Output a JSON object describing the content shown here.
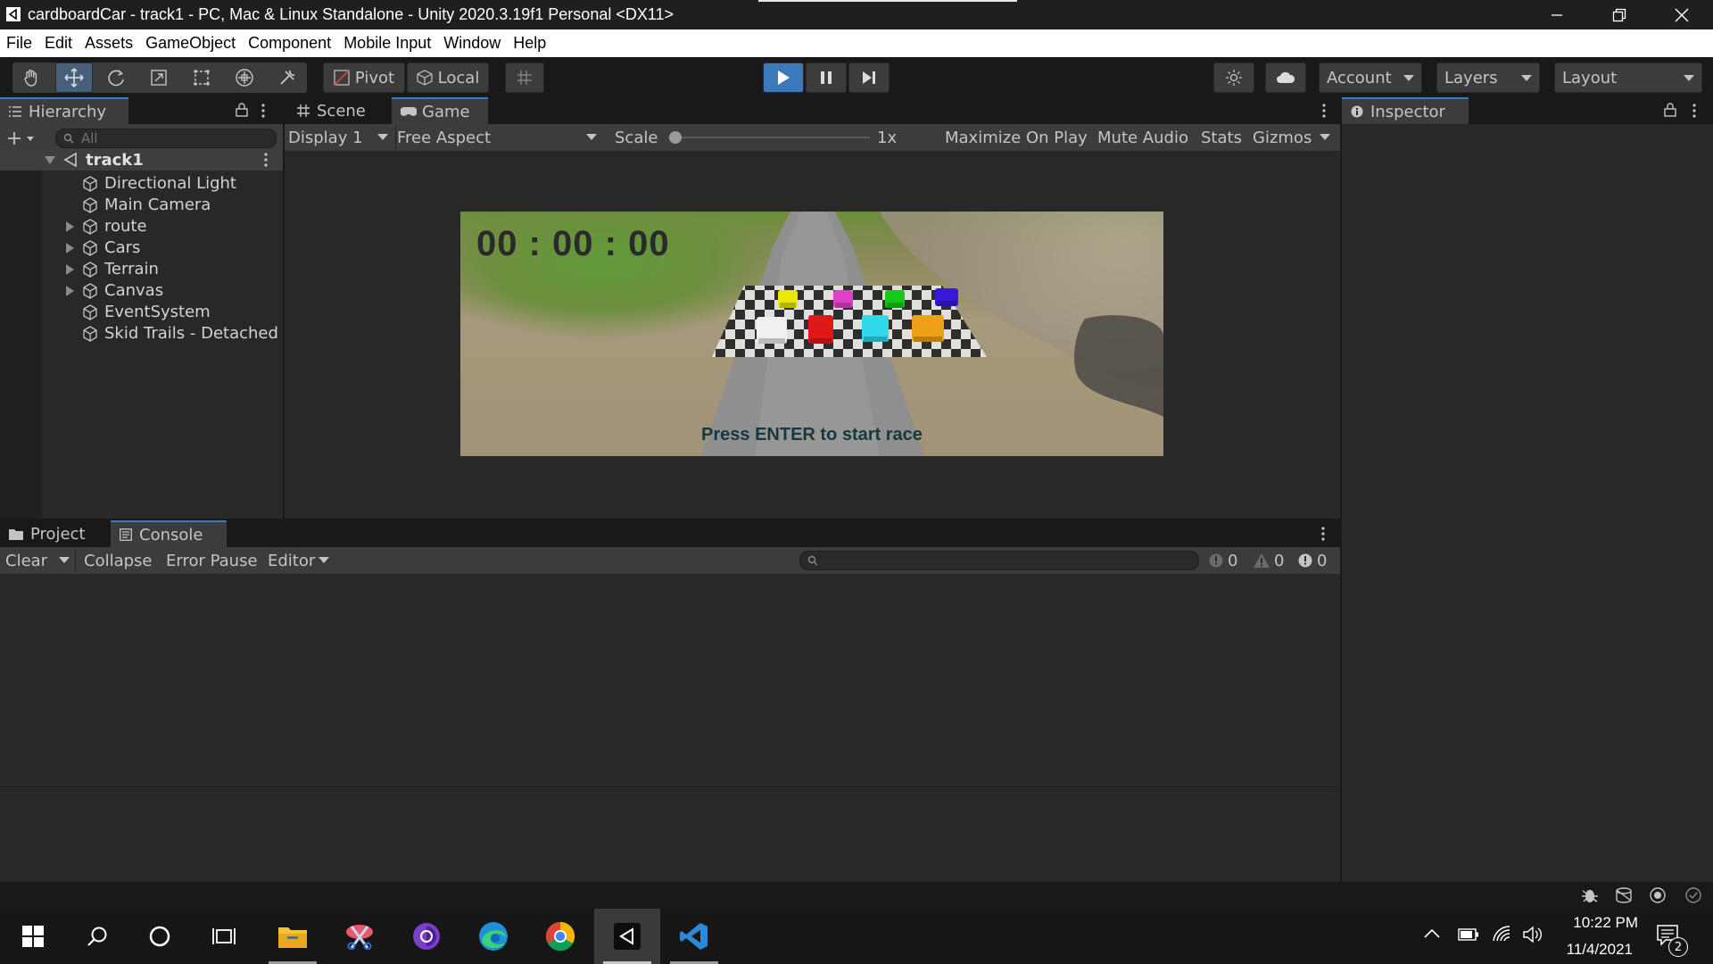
{
  "window": {
    "title": "cardboardCar - track1 - PC, Mac & Linux Standalone - Unity 2020.3.19f1 Personal <DX11>"
  },
  "menu": [
    "File",
    "Edit",
    "Assets",
    "GameObject",
    "Component",
    "Mobile Input",
    "Window",
    "Help"
  ],
  "toolbar": {
    "pivot": "Pivot",
    "local": "Local",
    "account": "Account",
    "layers": "Layers",
    "layout": "Layout"
  },
  "hierarchy": {
    "tab": "Hierarchy",
    "search_placeholder": "All",
    "scene": "track1",
    "items": [
      {
        "label": "Directional Light",
        "has_children": false
      },
      {
        "label": "Main Camera",
        "has_children": false
      },
      {
        "label": "route",
        "has_children": true
      },
      {
        "label": "Cars",
        "has_children": true
      },
      {
        "label": "Terrain",
        "has_children": true
      },
      {
        "label": "Canvas",
        "has_children": true
      },
      {
        "label": "EventSystem",
        "has_children": false
      },
      {
        "label": "Skid Trails - Detached",
        "has_children": false
      }
    ]
  },
  "center": {
    "tabs": [
      "Scene",
      "Game"
    ],
    "active_tab": "Game",
    "display": "Display 1",
    "aspect": "Free Aspect",
    "scale_label": "Scale",
    "scale_value": "1x",
    "buttons": [
      "Maximize On Play",
      "Mute Audio",
      "Stats",
      "Gizmos"
    ]
  },
  "game": {
    "timer": "00 : 00 : 00",
    "prompt": "Press ENTER to start race",
    "car_colors": [
      "#e8e800",
      "#e040c8",
      "#18c818",
      "#3a18d8",
      "#f0f0f0",
      "#e01818",
      "#30d8e8",
      "#f0a018"
    ]
  },
  "inspector": {
    "tab": "Inspector"
  },
  "bottom": {
    "tabs": [
      "Project",
      "Console"
    ],
    "active_tab": "Console",
    "clear": "Clear",
    "collapse": "Collapse",
    "error_pause": "Error Pause",
    "editor": "Editor",
    "counts": {
      "log": "0",
      "warn": "0",
      "error": "0"
    }
  },
  "taskbar": {
    "time": "10:22 PM",
    "date": "11/4/2021",
    "notifications": "2"
  }
}
